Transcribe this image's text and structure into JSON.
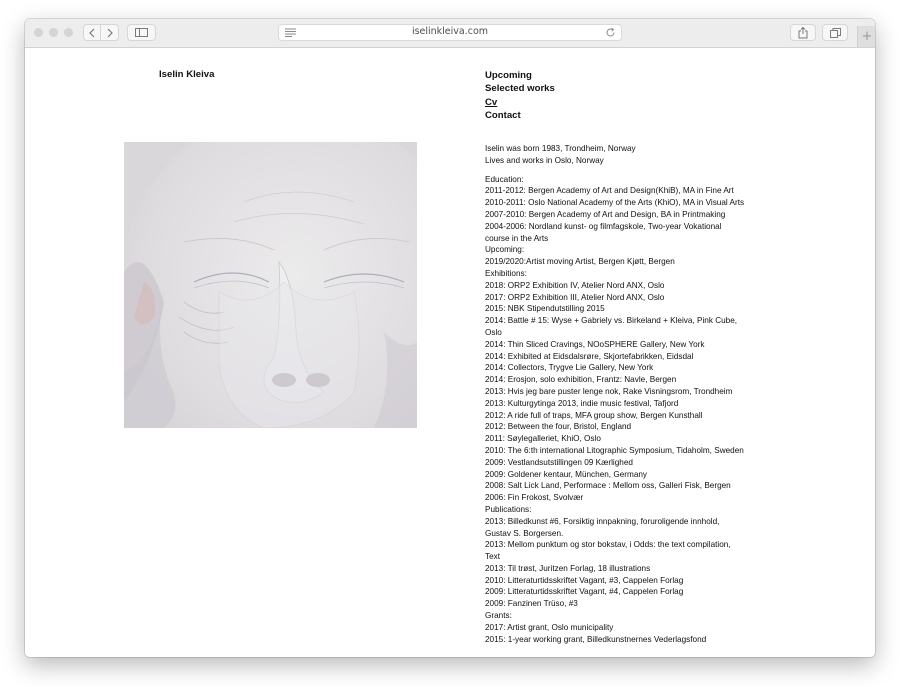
{
  "browser": {
    "url": "iselinkleiva.com",
    "newtab_label": "+"
  },
  "site": {
    "title": "Iselin Kleiva",
    "nav": [
      "Upcoming",
      "Selected works",
      "Cv",
      "Contact"
    ],
    "current_nav": "Cv"
  },
  "cv": {
    "intro": [
      "Iselin was born 1983, Trondheim, Norway",
      "Lives and works in Oslo, Norway"
    ],
    "lines": [
      "Education:",
      "2011-2012: Bergen Academy of Art and Design(KhiB), MA in Fine Art",
      "2010-2011: Oslo National Academy of the Arts (KhiO), MA in Visual Arts",
      "2007-2010: Bergen Academy of Art and Design, BA in Printmaking",
      "2004-2006: Nordland kunst- og filmfagskole, Two-year Vokational course in the Arts",
      "Upcoming:",
      "2019/2020:Artist moving Artist, Bergen Kjøtt, Bergen",
      "Exhibitions:",
      "2018: ORP2 Exhibition IV, Atelier Nord ANX, Oslo",
      "2017: ORP2 Exhibition III, Atelier Nord ANX, Oslo",
      "2015: NBK Stipendutstilling 2015",
      "2014: Battle # 15: Wyse + Gabriely vs. Birkeland + Kleiva, Pink Cube, Oslo",
      "2014: Thin Sliced Cravings, NOoSPHERE Gallery, New York",
      "2014: Exhibited at Eidsdalsrøre, Skjortefabrikken, Eidsdal",
      "2014: Collectors, Trygve Lie Gallery, New York",
      "2014: Erosjon, solo exhibition, Frantz: Navle, Bergen",
      "2013: Hvis jeg bare puster lenge nok, Rake Visningsrom, Trondheim",
      "2013: Kulturgytinga 2013, indie music festival, Tafjord",
      "2012: A ride full of traps, MFA group show, Bergen Kunsthall",
      "2012: Between the four, Bristol, England",
      "2011: Søylegalleriet, KhiO, Oslo",
      "2010: The 6:th international Litographic Symposium, Tidaholm, Sweden",
      "2009: Vestlandsutstillingen 09 Kærlighed",
      "2009: Goldener kentaur, München, Germany",
      "2008: Salt Lick Land, Performace : Mellom oss, Galleri Fisk, Bergen",
      "2006: Fin Frokost, Svolvær",
      "Publications:",
      "2013: Billedkunst #6, Forsiktig innpakning, foruroligende innhold, Gustav S. Borgersen.",
      "2013: Mellom punktum og stor bokstav, i Odds: the text compilation, Text",
      "2013: Til trøst, Juritzen Forlag, 18 illustrations",
      "2010: Litteraturtidsskriftet Vagant, #3, Cappelen Forlag",
      "2009: Litteraturtidsskriftet Vagant, #4, Cappelen Forlag",
      "2009: Fanzinen Trüso, #3",
      "Grants:",
      "2017: Artist grant, Oslo municipality",
      "2015: 1-year working grant, Billedkunstnernes Vederlagsfond"
    ]
  }
}
